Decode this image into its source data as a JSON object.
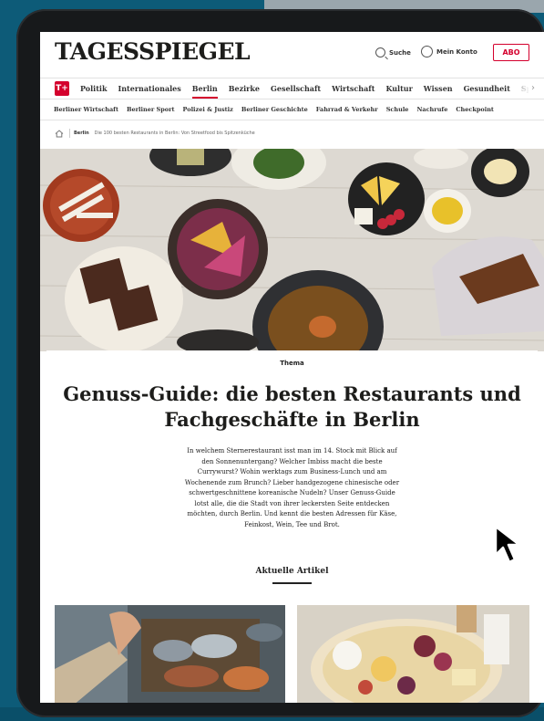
{
  "header": {
    "logo": "TAGESSPIEGEL",
    "search_label": "Suche",
    "account_label": "Mein Konto",
    "abo_label": "ABO",
    "brand_color": "#d4002d"
  },
  "nav_primary": {
    "badge": "T+",
    "items": [
      "Politik",
      "Internationales",
      "Berlin",
      "Bezirke",
      "Gesellschaft",
      "Wirtschaft",
      "Kultur",
      "Wissen",
      "Gesundheit",
      "Sport"
    ],
    "active": "Berlin"
  },
  "nav_secondary": {
    "items": [
      "Berliner Wirtschaft",
      "Berliner Sport",
      "Polizei & Justiz",
      "Berliner Geschichte",
      "Fahrrad & Verkehr",
      "Schule",
      "Nachrufe",
      "Checkpoint"
    ]
  },
  "breadcrumb": {
    "section": "Berlin",
    "page": "Die 100 besten Restaurants in Berlin: Von Streetfood bis Spitzenküche"
  },
  "article": {
    "kicker": "Thema",
    "title": "Genuss-Guide: die besten Restaurants und Fachgeschäfte in Berlin",
    "lead": "In welchem Sternerestaurant isst man im 14. Stock mit Blick auf den Sonnenuntergang? Welcher Imbiss macht die beste Currywurst? Wohin werktags zum Business-Lunch und am Wochenende zum Brunch? Lieber handgezogene chinesische oder schwertgeschnittene koreanische Nudeln? Unser Genuss-Guide lotst alle, die die Stadt von ihrer leckersten Seite entdecken möchten, durch Berlin. Und kennt die besten Adressen für Käse, Feinkost, Wein, Tee und Brot."
  },
  "section": {
    "heading": "Aktuelle Artikel"
  }
}
